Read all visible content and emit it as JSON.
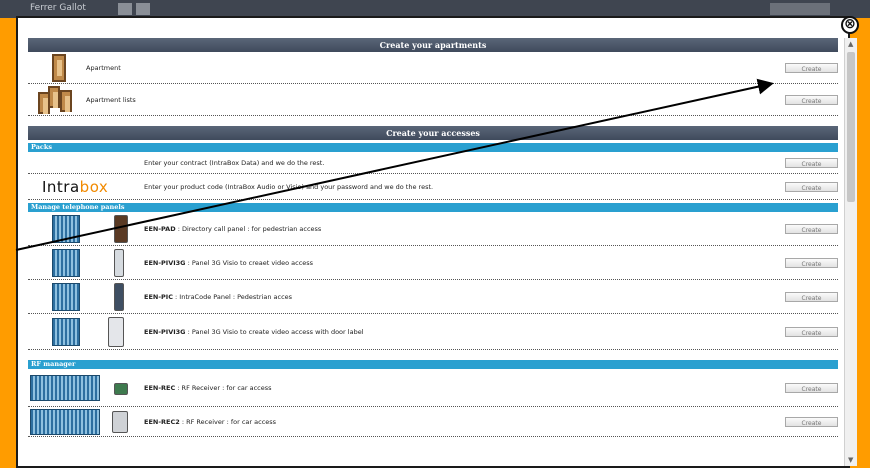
{
  "window": {
    "title": "Ferrer Gallot"
  },
  "dialog": {
    "close_symbol": "⊗",
    "sections": {
      "apartments": {
        "title": "Create your apartments",
        "rows": [
          {
            "label": "Apartment",
            "button": "Create",
            "icon": "door-icon"
          },
          {
            "label": "Apartment lists",
            "button": "Create",
            "icon": "doors-icon"
          }
        ]
      },
      "accesses": {
        "title": "Create your accesses",
        "packs": {
          "title": "Packs",
          "rows": [
            {
              "text": "Enter your contract (IntraBox Data) and we do the rest.",
              "button": "Create"
            },
            {
              "logo_main": "Intra",
              "logo_accent": "box",
              "text": "Enter your product code (IntraBox Audio or Visio) and your password and we do the rest.",
              "button": "Create"
            }
          ]
        },
        "telephone_panels": {
          "title": "Manage telephone panels",
          "rows": [
            {
              "code": "EEN-PAD",
              "desc": " : Directory call panel : for pedestrian access",
              "button": "Create"
            },
            {
              "code": "EEN-PIVI3G",
              "desc": " : Panel 3G Visio to creaet video access",
              "button": "Create"
            },
            {
              "code": "EEN-PIC",
              "desc": " : IntraCode Panel : Pedestrian acces",
              "button": "Create"
            },
            {
              "code": "EEN-PIVI3G",
              "desc": " : Panel 3G Visio to create video access with door label",
              "button": "Create"
            }
          ]
        },
        "rf_manager": {
          "title": "RF manager",
          "rows": [
            {
              "code": "EEN-REC",
              "desc": " : RF Receiver : for car access",
              "button": "Create"
            },
            {
              "code": "EEN-REC2",
              "desc": " : RF Receiver : for car access",
              "button": "Create"
            }
          ]
        }
      }
    }
  },
  "colors": {
    "background": "#ff9c00",
    "section_header": "#4a5567",
    "sub_header": "#2aa0d0",
    "logo_accent": "#f18a00"
  }
}
